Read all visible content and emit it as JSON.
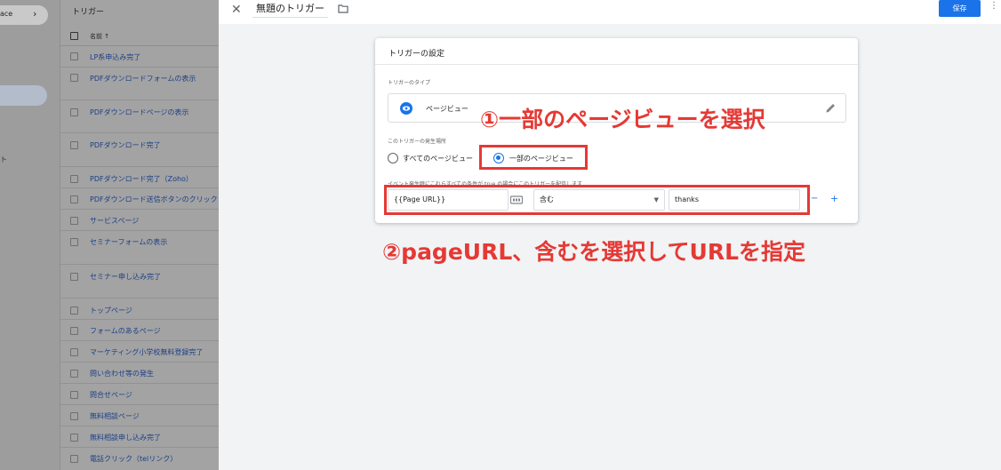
{
  "nav": {
    "workspace_label": "ace",
    "nav_fragment": "ト"
  },
  "list": {
    "title": "トリガー",
    "name_header": "名前 ↑",
    "items": [
      "LP系申込み完了",
      "PDFダウンロードフォームの表示",
      "PDFダウンロードページの表示",
      "PDFダウンロード完了",
      "PDFダウンロード完了（Zoho）",
      "PDFダウンロード送信ボタンのクリック",
      "サービスページ",
      "セミナーフォームの表示",
      "セミナー申し込み完了",
      "トップページ",
      "フォームのあるページ",
      "マーケティング小学校無料登録完了",
      "問い合わせ等の発生",
      "問合せページ",
      "無料相談ページ",
      "無料相談申し込み完了",
      "電話クリック（telリンク）"
    ]
  },
  "editor": {
    "trigger_name": "無題のトリガー",
    "save_label": "保存",
    "card_title": "トリガーの設定",
    "type_label": "トリガーのタイプ",
    "type_name": "ページビュー",
    "fire_label": "このトリガーの発生場所",
    "radio_all": "すべてのページビュー",
    "radio_some": "一部のページビュー",
    "condition_label": "イベント発生時にこれらすべての条件が true の場合にこのトリガーを配信します",
    "variable": "{{Page URL}}",
    "operator": "含む",
    "value": "thanks",
    "minus": "−",
    "plus": "+"
  },
  "annotations": {
    "step1": "①一部のページビューを選択",
    "step2": "②pageURL、含むを選択してURLを指定"
  },
  "colors": {
    "accent": "#1a73e8",
    "highlight": "#e53935"
  }
}
